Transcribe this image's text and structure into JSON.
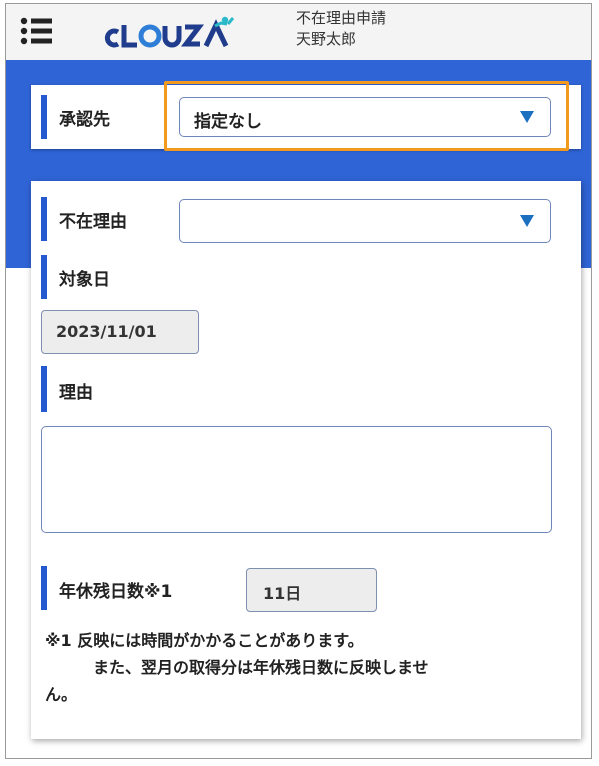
{
  "header": {
    "logo_text": "cLOUZA",
    "page_title": "不在理由申請",
    "user_name": "天野太郎"
  },
  "approver": {
    "label": "承認先",
    "selected": "指定なし"
  },
  "form": {
    "absence_reason": {
      "label": "不在理由",
      "selected": ""
    },
    "target_date": {
      "label": "対象日",
      "value": "2023/11/01"
    },
    "reason": {
      "label": "理由",
      "value": ""
    },
    "leave_balance": {
      "label": "年休残日数※1",
      "value": "11日"
    },
    "notes": {
      "line1": "※1 反映には時間がかかることがあります。",
      "line2": "また、翌月の取得分は年休残日数に反映しませ",
      "line3": "ん。"
    }
  },
  "colors": {
    "band": "#2f64d6",
    "label_bar": "#2459d0",
    "highlight": "#f29a1e",
    "select_arrow": "#1d6fc0"
  },
  "icons": [
    "menu-icon",
    "dropdown-arrow-icon"
  ]
}
